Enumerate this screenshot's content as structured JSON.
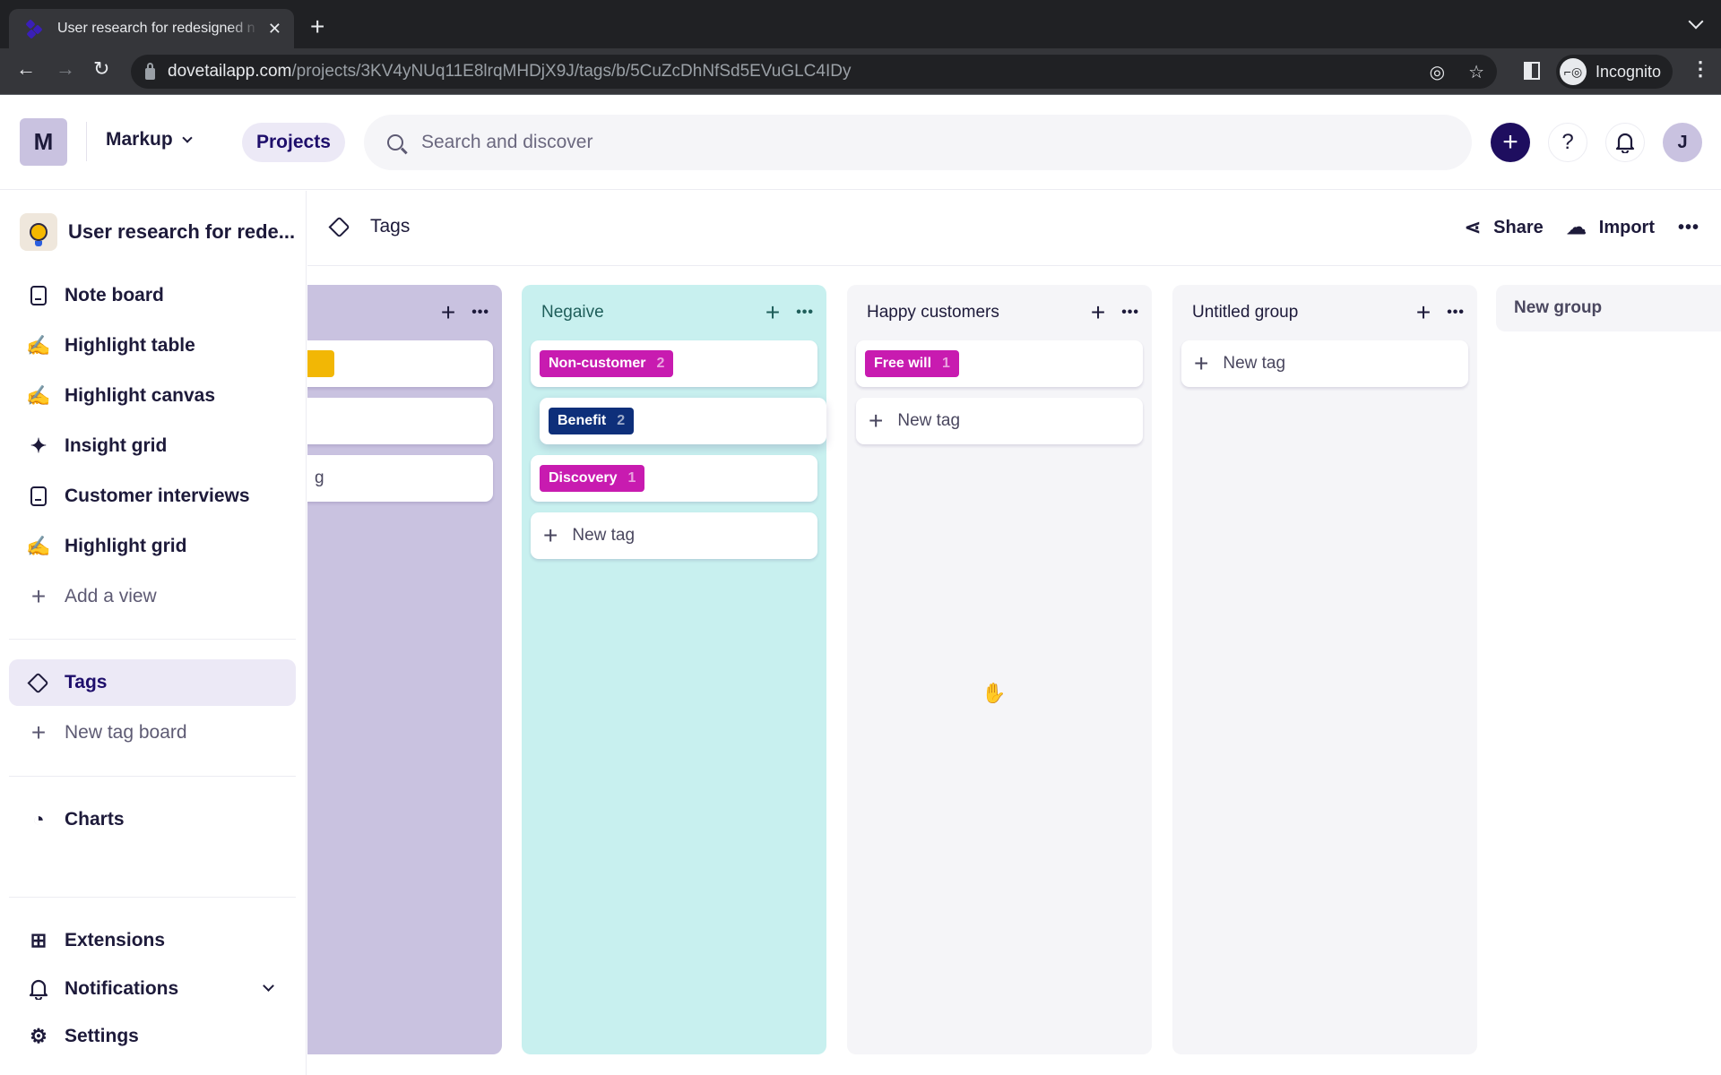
{
  "browser": {
    "tab_title": "User research for redesigned n",
    "url_host": "dovetailapp.com",
    "url_path": "/projects/3KV4yNUq11E8lrqMHDjX9J/tags/b/5CuZcDhNfSd5EVuGLC4IDy",
    "profile_label": "Incognito"
  },
  "header": {
    "workspace_initial": "M",
    "workspace_name": "Markup",
    "projects_label": "Projects",
    "search_placeholder": "Search and discover",
    "help_glyph": "?",
    "user_initial": "J"
  },
  "sidebar": {
    "project_name": "User research for rede...",
    "views": [
      {
        "label": "Note board",
        "icon": "document-icon"
      },
      {
        "label": "Highlight table",
        "icon": "highlighter-icon"
      },
      {
        "label": "Highlight canvas",
        "icon": "highlighter-icon"
      },
      {
        "label": "Insight grid",
        "icon": "sparkle-icon"
      },
      {
        "label": "Customer interviews",
        "icon": "document-icon"
      },
      {
        "label": "Highlight grid",
        "icon": "highlighter-icon"
      }
    ],
    "add_view_label": "Add a view",
    "tags_label": "Tags",
    "new_tag_board_label": "New tag board",
    "charts_label": "Charts",
    "extensions_label": "Extensions",
    "notifications_label": "Notifications",
    "settings_label": "Settings"
  },
  "main": {
    "title": "Tags",
    "share_label": "Share",
    "import_label": "Import"
  },
  "board": {
    "columns": [
      {
        "title": "",
        "color": "#c9c2e0",
        "cards": [
          {
            "type": "tag-partial",
            "label": "",
            "chip_color": "#f2b705"
          },
          {
            "type": "empty",
            "label": ""
          },
          {
            "type": "new-tag-partial",
            "label": "g"
          }
        ]
      },
      {
        "title": "Negaive",
        "color": "#c8f0ef",
        "title_color": "#1f5e5a",
        "tags": [
          {
            "label": "Non-customer",
            "count": "2",
            "color": "#c81bb0"
          },
          {
            "label": "Benefit",
            "count": "2",
            "color": "#0e2f7a"
          },
          {
            "label": "Discovery",
            "count": "1",
            "color": "#c81bb0"
          }
        ],
        "new_tag_label": "New tag"
      },
      {
        "title": "Happy customers",
        "color": "#f5f5f8",
        "tags": [
          {
            "label": "Free will",
            "count": "1",
            "color": "#c81bb0"
          }
        ],
        "new_tag_label": "New tag"
      },
      {
        "title": "Untitled group",
        "color": "#f5f5f8",
        "tags": [],
        "new_tag_label": "New tag"
      }
    ],
    "new_group_label": "New group"
  }
}
